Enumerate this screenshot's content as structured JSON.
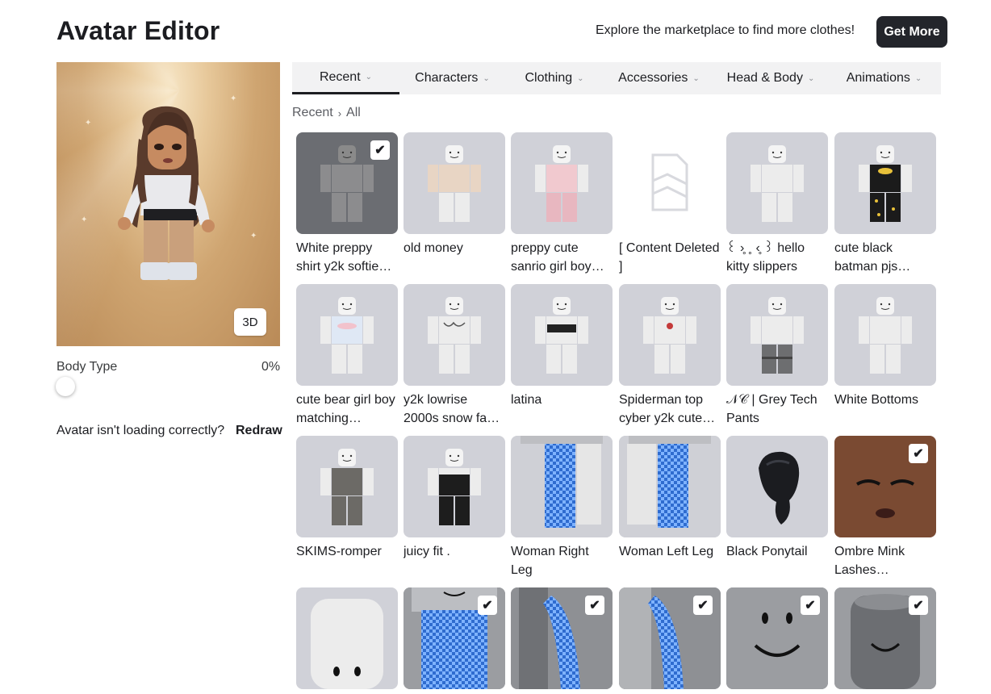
{
  "header": {
    "title": "Avatar Editor",
    "promo_text": "Explore the marketplace to find more clothes!",
    "get_more_label": "Get More"
  },
  "preview": {
    "toggle_3d_label": "3D",
    "body_type_label": "Body Type",
    "body_type_value": "0%",
    "loading_question": "Avatar isn't loading correctly?",
    "redraw_label": "Redraw"
  },
  "tabs": [
    {
      "label": "Recent",
      "active": true
    },
    {
      "label": "Characters",
      "active": false
    },
    {
      "label": "Clothing",
      "active": false
    },
    {
      "label": "Accessories",
      "active": false
    },
    {
      "label": "Head & Body",
      "active": false
    },
    {
      "label": "Animations",
      "active": false
    }
  ],
  "breadcrumb": {
    "root": "Recent",
    "separator": "›",
    "current": "All"
  },
  "items": [
    {
      "name": "White preppy shirt y2k softie…",
      "thumb": "dark",
      "figure": "gray-shirt",
      "checked": true
    },
    {
      "name": "old money",
      "thumb": "light",
      "figure": "beige-knit",
      "checked": false
    },
    {
      "name": "preppy cute sanrio girl boy…",
      "thumb": "light",
      "figure": "pink-set",
      "checked": false
    },
    {
      "name": "[ Content Deleted ]",
      "thumb": "white",
      "figure": "deleted",
      "checked": false
    },
    {
      "name": "꒰ ›̥ ˳ ‹̥ ꒱ hello kitty slippers",
      "thumb": "light",
      "figure": "plain",
      "checked": false
    },
    {
      "name": "cute black batman pjs…",
      "thumb": "light",
      "figure": "batman",
      "checked": false
    },
    {
      "name": "cute bear girl boy matching…",
      "thumb": "light",
      "figure": "blue-top",
      "checked": false
    },
    {
      "name": "y2k lowrise 2000s snow fa…",
      "thumb": "light",
      "figure": "bikini",
      "checked": false
    },
    {
      "name": "latina",
      "thumb": "light",
      "figure": "latina",
      "checked": false
    },
    {
      "name": "Spiderman top cyber y2k cute…",
      "thumb": "light",
      "figure": "spider",
      "checked": false
    },
    {
      "name": "𝒩𝒞 | Grey Tech Pants",
      "thumb": "light",
      "figure": "tech-pants",
      "checked": false
    },
    {
      "name": "White Bottoms",
      "thumb": "light",
      "figure": "plain",
      "checked": false
    },
    {
      "name": "SKIMS-romper",
      "thumb": "light",
      "figure": "romper",
      "checked": false
    },
    {
      "name": "juicy fit .",
      "thumb": "light",
      "figure": "juicy",
      "checked": false
    },
    {
      "name": "Woman Right Leg",
      "thumb": "light",
      "figure": "leg-right",
      "checked": false
    },
    {
      "name": "Woman Left Leg",
      "thumb": "light",
      "figure": "leg-left",
      "checked": false
    },
    {
      "name": "Black Ponytail",
      "thumb": "light",
      "figure": "ponytail",
      "checked": false
    },
    {
      "name": "Ombre Mink Lashes Cheeks…",
      "thumb": "light",
      "figure": "face",
      "checked": true
    },
    {
      "name": "",
      "thumb": "light",
      "figure": "head",
      "checked": false
    },
    {
      "name": "",
      "thumb": "gray3d",
      "figure": "torso-check",
      "checked": true
    },
    {
      "name": "",
      "thumb": "gray3d",
      "figure": "arm-right",
      "checked": true
    },
    {
      "name": "",
      "thumb": "gray3d",
      "figure": "arm-left",
      "checked": true
    },
    {
      "name": "",
      "thumb": "gray3d",
      "figure": "smile",
      "checked": true
    },
    {
      "name": "",
      "thumb": "gray3d",
      "figure": "head-dark",
      "checked": true
    }
  ],
  "colors": {
    "accent_dark": "#23252b",
    "tile_bg": "#d0d1d8",
    "tab_bar_bg": "#f2f2f3"
  },
  "icons": {
    "check": "checkmark-icon",
    "chevron": "chevron-down-icon",
    "breadcrumb_sep": "chevron-right-icon"
  }
}
